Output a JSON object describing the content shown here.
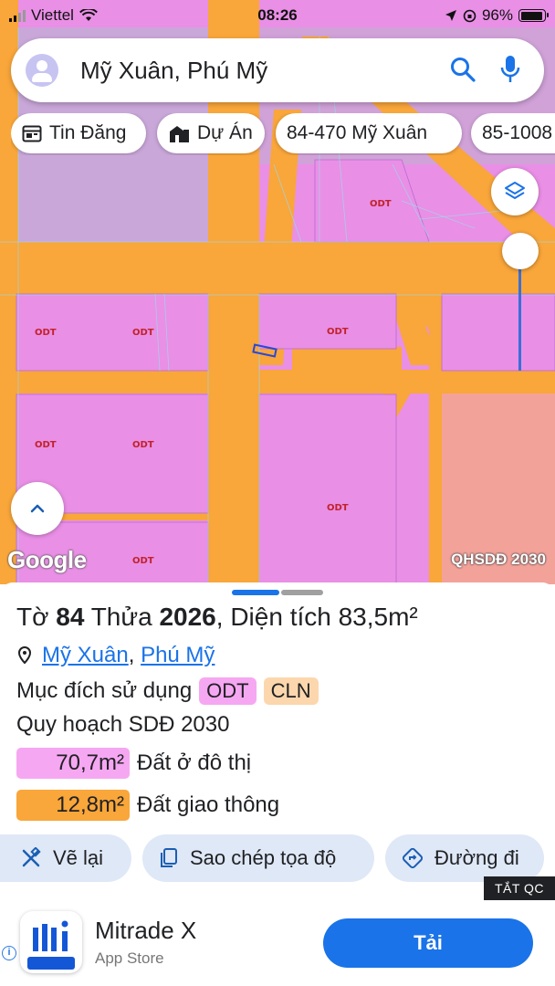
{
  "status_bar": {
    "carrier": "Viettel",
    "time": "08:26",
    "battery": "96%"
  },
  "search": {
    "query": "Mỹ Xuân, Phú Mỹ"
  },
  "chips": [
    {
      "label": "Tin Đăng",
      "icon": "calendar-icon"
    },
    {
      "label": "Dự Án",
      "icon": "building-icon"
    },
    {
      "label": "84-470 Mỹ Xuân",
      "icon": ""
    },
    {
      "label": "85-1008",
      "icon": ""
    }
  ],
  "map": {
    "parcel_labels": [
      "ODT",
      "ODT",
      "ODT",
      "ODT",
      "ODT",
      "ODT",
      "ODT",
      "ODT"
    ],
    "google_label": "Google",
    "layer_label": "QHSDĐ 2030",
    "colors": {
      "residential": "#e98fe6",
      "road": "#f9a63a",
      "other": "#f3a29a",
      "overlay": "#c9a7d9"
    },
    "opacity_slider": 0.35
  },
  "parcel": {
    "sheet_prefix": "Tờ",
    "sheet_number": "84",
    "lot_prefix": "Thửa",
    "lot_number": "2026",
    "area_prefix": ", Diện tích",
    "area_value": "83,5m²",
    "location_ward": "Mỹ Xuân",
    "location_district": "Phú Mỹ",
    "purpose_label": "Mục đích sử dụng",
    "purpose_tags": [
      "ODT",
      "CLN"
    ],
    "plan_label": "Quy hoạch SDĐ 2030",
    "plan_areas": [
      {
        "value": "70,7m²",
        "label": "Đất ở đô thị",
        "color": "#f6a7f2"
      },
      {
        "value": "12,8m²",
        "label": "Đất giao thông",
        "color": "#f9a63a"
      }
    ]
  },
  "actions": {
    "redraw": "Vẽ lại",
    "copy_coords": "Sao chép tọa độ",
    "directions": "Đường đi"
  },
  "ad": {
    "hide_label": "TẮT QC",
    "app_name": "Mitrade X",
    "store": "App Store",
    "button": "Tải"
  }
}
